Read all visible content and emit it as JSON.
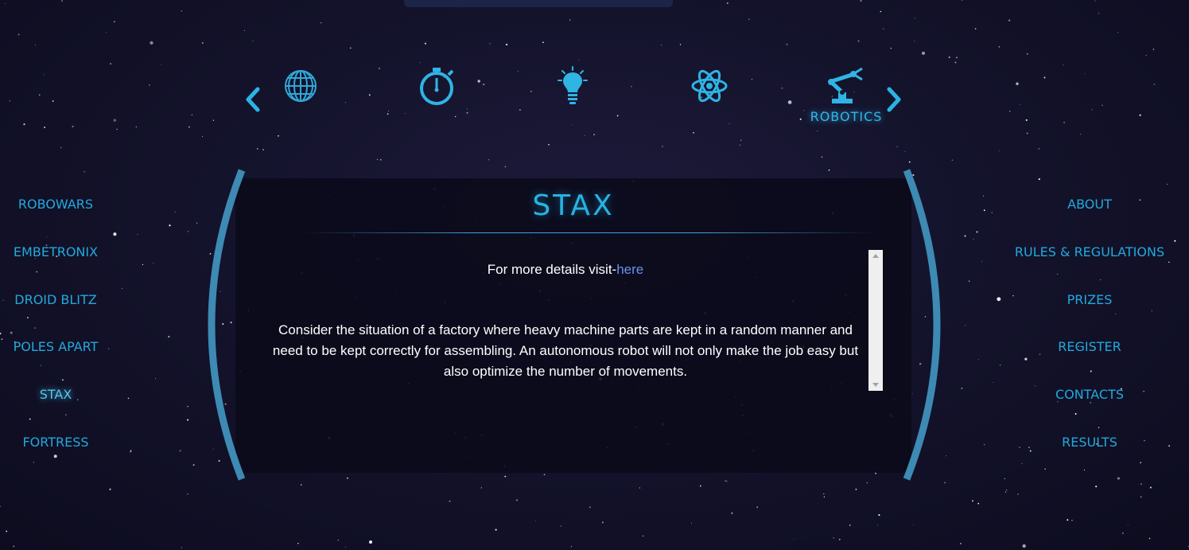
{
  "colors": {
    "accent": "#22a9dc",
    "accent_glow": "#4fc6ee",
    "bracket": "#3d8ab3",
    "panel_bg": "#0a0a1a",
    "link": "#6a8ff0"
  },
  "carousel": {
    "prev_icon": "chevron-left-icon",
    "next_icon": "chevron-right-icon",
    "categories": [
      {
        "icon": "globe-icon"
      },
      {
        "icon": "stopwatch-icon"
      },
      {
        "icon": "lightbulb-icon"
      },
      {
        "icon": "atom-icon"
      },
      {
        "icon": "robotic-arm-icon",
        "label": "ROBOTICS",
        "active": true
      }
    ]
  },
  "left_nav": {
    "items": [
      {
        "label": "ROBOWARS"
      },
      {
        "label": "EMBETRONIX"
      },
      {
        "label": "DROID BLITZ"
      },
      {
        "label": "POLES APART"
      },
      {
        "label": "STAX",
        "active": true
      },
      {
        "label": "FORTRESS"
      }
    ]
  },
  "right_nav": {
    "items": [
      {
        "label": "ABOUT"
      },
      {
        "label": "RULES & REGULATIONS"
      },
      {
        "label": "PRIZES"
      },
      {
        "label": "REGISTER"
      },
      {
        "label": "CONTACTS"
      },
      {
        "label": "RESULTS"
      }
    ]
  },
  "panel": {
    "title": "STAX",
    "details_prefix": "For more details visit-",
    "details_link": "here",
    "description": "Consider the situation of a factory where heavy machine parts are kept in a random manner and need to be kept correctly for assembling. An autonomous robot will not only make the job easy but also optimize the number of movements."
  }
}
